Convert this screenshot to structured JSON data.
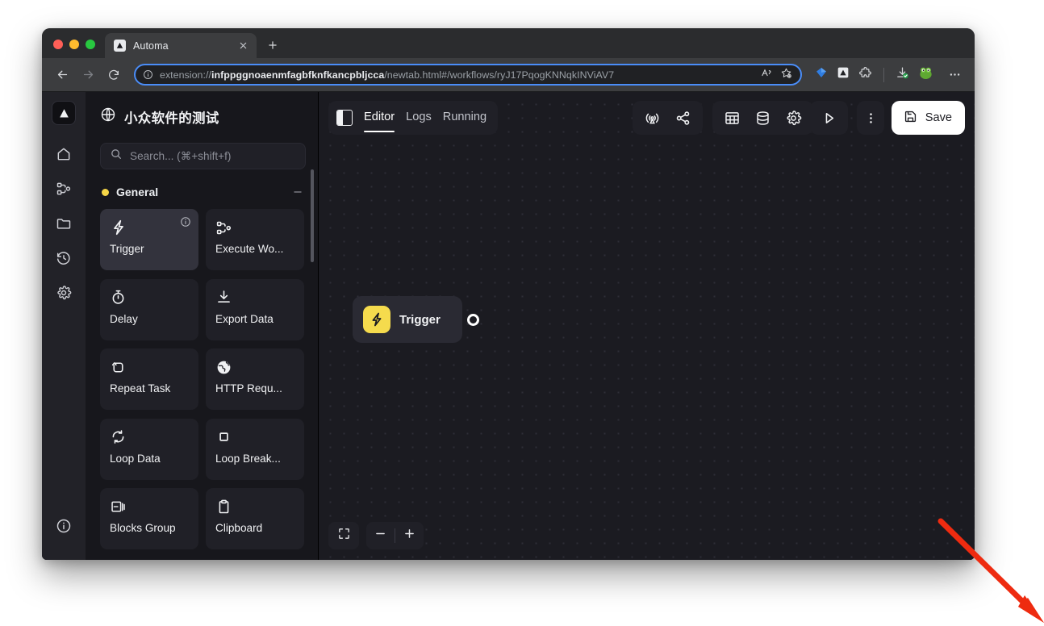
{
  "browser": {
    "tab": {
      "title": "Automa",
      "favicon_icon": "automa-logo-icon",
      "close_icon": "close-icon"
    },
    "new_tab_icon": "plus-icon",
    "nav": {
      "back_icon": "arrow-left-icon",
      "forward_icon": "arrow-right-icon",
      "reload_icon": "reload-icon"
    },
    "omnibox": {
      "info_icon": "info-circle-icon",
      "url_prefix": "extension://",
      "url_host": "infppggnoaenmfagbfknfkancpbljcca",
      "url_path": "/newtab.html#/workflows/ryJ17PqogKNNqkINViAV7",
      "full_url": "extension://infppggnoaenmfagbfknfkancpbljcca/newtab.html#/workflows/ryJ17PqogKNNqkINViAV7",
      "read_aloud_icon": "read-aloud-icon",
      "favorite_icon": "star-add-icon"
    },
    "extensions": [
      {
        "name": "diamond-extension-icon",
        "color": "#2f7de1"
      },
      {
        "name": "automa-extension-icon",
        "color": "#e8eaed"
      },
      {
        "name": "extensions-puzzle-icon",
        "color": "#d6d8db"
      },
      {
        "name": "downloads-icon",
        "color": "#d6d8db"
      },
      {
        "name": "profile-avatar-icon",
        "color": "#5fa832"
      }
    ],
    "more_menu_icon": "more-horizontal-icon"
  },
  "rail": {
    "logo_icon": "automa-logo-icon",
    "items": [
      {
        "name": "home",
        "icon": "home-icon"
      },
      {
        "name": "workflows",
        "icon": "workflow-nodes-icon"
      },
      {
        "name": "folders",
        "icon": "folder-icon"
      },
      {
        "name": "history",
        "icon": "clock-history-icon"
      },
      {
        "name": "settings",
        "icon": "gear-icon"
      }
    ],
    "bottom_item": {
      "name": "about",
      "icon": "info-circle-icon"
    }
  },
  "sidebar": {
    "workflow_title": "小众软件的测试",
    "workflow_icon": "globe-icon",
    "search": {
      "placeholder": "Search... (⌘+shift+f)",
      "value": "",
      "icon": "search-icon"
    },
    "group": {
      "label": "General",
      "dot_color": "#f5d547",
      "collapse_icon": "minus-icon"
    },
    "blocks": [
      {
        "label": "Trigger",
        "icon": "lightning-bolt-icon",
        "active": true,
        "info_icon": "info-circle-icon"
      },
      {
        "label": "Execute Wo...",
        "icon": "workflow-nodes-icon",
        "active": false
      },
      {
        "label": "Delay",
        "icon": "stopwatch-icon",
        "active": false
      },
      {
        "label": "Export Data",
        "icon": "download-icon",
        "active": false
      },
      {
        "label": "Repeat Task",
        "icon": "repeat-icon",
        "active": false
      },
      {
        "label": "HTTP Requ...",
        "icon": "globe-filled-icon",
        "active": false
      },
      {
        "label": "Loop Data",
        "icon": "refresh-circle-icon",
        "active": false
      },
      {
        "label": "Loop Break...",
        "icon": "square-stop-icon",
        "active": false
      },
      {
        "label": "Blocks Group",
        "icon": "blocks-group-icon",
        "active": false
      },
      {
        "label": "Clipboard",
        "icon": "clipboard-icon",
        "active": false
      }
    ]
  },
  "editor": {
    "panel_toggle_icon": "panel-toggle-icon",
    "tabs": [
      {
        "label": "Editor",
        "active": true
      },
      {
        "label": "Logs",
        "active": false
      },
      {
        "label": "Running",
        "active": false
      }
    ],
    "toolbar_group_1": [
      {
        "name": "record-workflow",
        "icon": "broadcast-icon"
      },
      {
        "name": "share-workflow",
        "icon": "share-icon"
      }
    ],
    "toolbar_group_2": [
      {
        "name": "workflow-table",
        "icon": "table-icon"
      },
      {
        "name": "workflow-storage",
        "icon": "database-icon"
      },
      {
        "name": "workflow-settings",
        "icon": "gear-icon"
      }
    ],
    "toolbar_group_3": [
      {
        "name": "run-workflow",
        "icon": "play-icon"
      }
    ],
    "more_icon": "more-vertical-icon",
    "save": {
      "label": "Save",
      "icon": "save-disk-icon"
    },
    "zoom_controls": {
      "fit_icon": "fit-view-icon",
      "zoom_out_icon": "minus-icon",
      "zoom_in_icon": "plus-icon"
    },
    "nodes": [
      {
        "label": "Trigger",
        "icon": "lightning-bolt-icon",
        "icon_bg": "#f5db4d",
        "handle": "output-handle"
      }
    ]
  },
  "annotation": {
    "arrow_color": "#ee2b10",
    "name": "red-pointer-arrow"
  }
}
